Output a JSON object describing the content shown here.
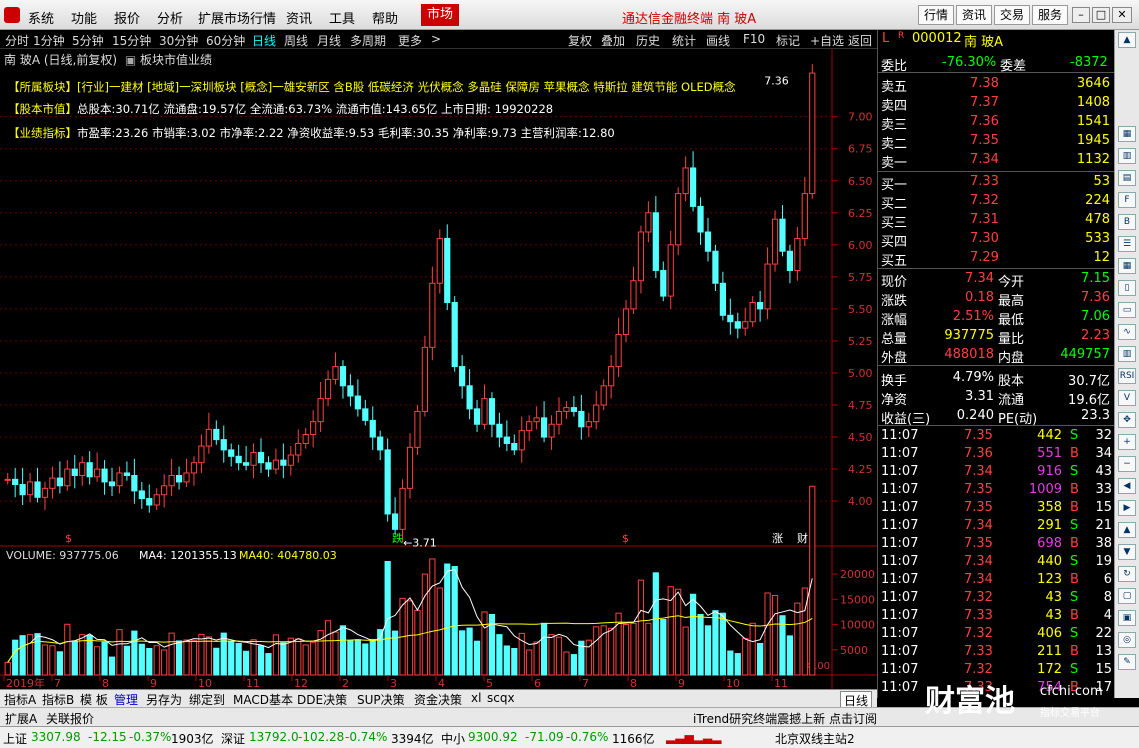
{
  "menu": {
    "items": [
      "系统",
      "功能",
      "报价",
      "分析",
      "扩展市场行情",
      "资讯",
      "工具",
      "帮助"
    ],
    "market": "市场",
    "title": "通达信金融终端  南 玻A",
    "right_buttons": [
      "行情",
      "资讯",
      "交易",
      "服务"
    ]
  },
  "periods": {
    "items": [
      "分时",
      "1分钟",
      "5分钟",
      "15分钟",
      "30分钟",
      "60分钟",
      "日线",
      "周线",
      "月线",
      "多周期",
      "更多"
    ],
    "active": "日线",
    "tools": [
      "复权",
      "叠加",
      "历史",
      "统计",
      "画线",
      "F10",
      "标记",
      "+自选",
      "返回"
    ]
  },
  "chart_head": {
    "title": "南 玻A (日线,前复权)",
    "tab": "板块市值业绩"
  },
  "info_lines": [
    {
      "key": "【所属板块】",
      "text": "[行业]一建材 [地域]一深圳板块 [概念]一雄安新区 含B股 低碳经济 光伏概念 多晶硅 保障房 苹果概念 特斯拉 建筑节能 OLED概念"
    },
    {
      "key": "【股本市值】",
      "text": "总股本:30.71亿 流通盘:19.57亿 全流通:63.73% 流通市值:143.65亿 上市日期: 19920228"
    },
    {
      "key": "【业绩指标】",
      "text": "市盈率:23.26 市销率:3.02 市净率:2.22 净资收益率:9.53 毛利率:30.35 净利率:9.73 主营利润率:12.80"
    }
  ],
  "chart_data": {
    "type": "candlestick",
    "price_axis_ticks": [
      4.0,
      4.25,
      4.5,
      4.75,
      5.0,
      5.25,
      5.5,
      5.75,
      6.0,
      6.25,
      6.5,
      6.75,
      7.0
    ],
    "ylim": [
      3.65,
      7.45
    ],
    "high_label": "7.36",
    "low_label": "3.71",
    "x_labels": [
      "2019年",
      "7",
      "8",
      "9",
      "10",
      "11",
      "12",
      "2",
      "3",
      "4",
      "5",
      "6",
      "7",
      "8",
      "9",
      "10",
      "11"
    ],
    "markers": [
      "$",
      "跌",
      "$",
      "涨",
      "财"
    ],
    "volume": {
      "title": "VOLUME: 937775.06",
      "ma4": "MA4: 1201355.13",
      "ma40": "MA40: 404780.03",
      "ticks": [
        "20000",
        "15000",
        "10000",
        "5000"
      ],
      "unit": "X100",
      "ylim": [
        0,
        22000
      ]
    },
    "closes": [
      4.17,
      4.13,
      4.05,
      4.15,
      4.03,
      4.1,
      4.18,
      4.12,
      4.25,
      4.2,
      4.3,
      4.19,
      4.25,
      4.15,
      4.12,
      4.22,
      4.2,
      4.08,
      4.02,
      3.97,
      4.05,
      4.12,
      4.2,
      4.15,
      4.22,
      4.3,
      4.43,
      4.56,
      4.48,
      4.4,
      4.35,
      4.3,
      4.28,
      4.38,
      4.3,
      4.25,
      4.32,
      4.28,
      4.36,
      4.45,
      4.52,
      4.62,
      4.8,
      4.95,
      5.05,
      4.9,
      4.82,
      4.72,
      4.63,
      4.5,
      4.4,
      3.9,
      3.78,
      4.1,
      4.42,
      4.7,
      5.2,
      5.7,
      6.05,
      5.55,
      5.05,
      4.9,
      4.72,
      4.6,
      4.8,
      4.6,
      4.5,
      4.45,
      4.4,
      4.55,
      4.62,
      4.65,
      4.5,
      4.6,
      4.7,
      4.73,
      4.7,
      4.58,
      4.62,
      4.75,
      4.9,
      5.05,
      5.3,
      5.5,
      5.72,
      6.1,
      6.25,
      5.8,
      5.6,
      6.0,
      6.4,
      6.6,
      6.3,
      6.1,
      5.95,
      5.7,
      5.45,
      5.4,
      5.35,
      5.4,
      5.55,
      5.5,
      5.85,
      6.2,
      5.95,
      5.8,
      6.05,
      6.4,
      7.34
    ]
  },
  "quote": {
    "code": "000012",
    "name": "南 玻A",
    "wb_label": "委比",
    "wb": "-76.30%",
    "wc_label": "委差",
    "wc": "-8372",
    "sells": [
      {
        "l": "卖五",
        "p": "7.38",
        "v": "3646"
      },
      {
        "l": "卖四",
        "p": "7.37",
        "v": "1408"
      },
      {
        "l": "卖三",
        "p": "7.36",
        "v": "1541"
      },
      {
        "l": "卖二",
        "p": "7.35",
        "v": "1945"
      },
      {
        "l": "卖一",
        "p": "7.34",
        "v": "1132"
      }
    ],
    "buys": [
      {
        "l": "买一",
        "p": "7.33",
        "v": "53"
      },
      {
        "l": "买二",
        "p": "7.32",
        "v": "224"
      },
      {
        "l": "买三",
        "p": "7.31",
        "v": "478"
      },
      {
        "l": "买四",
        "p": "7.30",
        "v": "533"
      },
      {
        "l": "买五",
        "p": "7.29",
        "v": "12"
      }
    ],
    "stats": [
      {
        "l1": "现价",
        "v1": "7.34",
        "c1": "red",
        "l2": "今开",
        "v2": "7.15",
        "c2": "grn"
      },
      {
        "l1": "涨跌",
        "v1": "0.18",
        "c1": "red",
        "l2": "最高",
        "v2": "7.36",
        "c2": "red"
      },
      {
        "l1": "涨幅",
        "v1": "2.51%",
        "c1": "red",
        "l2": "最低",
        "v2": "7.06",
        "c2": "grn"
      },
      {
        "l1": "总量",
        "v1": "937775",
        "c1": "yel",
        "l2": "量比",
        "v2": "2.23",
        "c2": "red"
      },
      {
        "l1": "外盘",
        "v1": "488018",
        "c1": "red",
        "l2": "内盘",
        "v2": "449757",
        "c2": "grn"
      },
      {
        "l1": "换手",
        "v1": "4.79%",
        "c1": "wht",
        "l2": "股本",
        "v2": "30.7亿",
        "c2": "wht"
      },
      {
        "l1": "净资",
        "v1": "3.31",
        "c1": "wht",
        "l2": "流通",
        "v2": "19.6亿",
        "c2": "wht"
      },
      {
        "l1": "收益(三)",
        "v1": "0.240",
        "c1": "wht",
        "l2": "PE(动)",
        "v2": "23.3",
        "c2": "wht"
      }
    ],
    "ticks": [
      {
        "t": "11:07",
        "p": "7.35",
        "pc": "red",
        "v": "442",
        "vc": "yel",
        "s": "S",
        "n": "32"
      },
      {
        "t": "11:07",
        "p": "7.36",
        "pc": "red",
        "v": "551",
        "vc": "mag",
        "s": "B",
        "n": "34"
      },
      {
        "t": "11:07",
        "p": "7.34",
        "pc": "red",
        "v": "916",
        "vc": "mag",
        "s": "S",
        "n": "43"
      },
      {
        "t": "11:07",
        "p": "7.35",
        "pc": "red",
        "v": "1009",
        "vc": "mag",
        "s": "B",
        "n": "33"
      },
      {
        "t": "11:07",
        "p": "7.35",
        "pc": "red",
        "v": "358",
        "vc": "yel",
        "s": "B",
        "n": "15"
      },
      {
        "t": "11:07",
        "p": "7.34",
        "pc": "red",
        "v": "291",
        "vc": "yel",
        "s": "S",
        "n": "21"
      },
      {
        "t": "11:07",
        "p": "7.35",
        "pc": "red",
        "v": "698",
        "vc": "mag",
        "s": "B",
        "n": "38"
      },
      {
        "t": "11:07",
        "p": "7.34",
        "pc": "red",
        "v": "440",
        "vc": "yel",
        "s": "S",
        "n": "19"
      },
      {
        "t": "11:07",
        "p": "7.34",
        "pc": "red",
        "v": "123",
        "vc": "yel",
        "s": "B",
        "n": "6"
      },
      {
        "t": "11:07",
        "p": "7.32",
        "pc": "red",
        "v": "43",
        "vc": "yel",
        "s": "S",
        "n": "8"
      },
      {
        "t": "11:07",
        "p": "7.33",
        "pc": "red",
        "v": "43",
        "vc": "yel",
        "s": "B",
        "n": "4"
      },
      {
        "t": "11:07",
        "p": "7.32",
        "pc": "red",
        "v": "406",
        "vc": "yel",
        "s": "S",
        "n": "22"
      },
      {
        "t": "11:07",
        "p": "7.33",
        "pc": "red",
        "v": "211",
        "vc": "yel",
        "s": "B",
        "n": "13"
      },
      {
        "t": "11:07",
        "p": "7.32",
        "pc": "red",
        "v": "172",
        "vc": "yel",
        "s": "S",
        "n": "15"
      },
      {
        "t": "11:07",
        "p": "7.33",
        "pc": "red",
        "v": "754",
        "vc": "mag",
        "s": "B",
        "n": "17"
      }
    ]
  },
  "bottom_tabs": [
    "指标A",
    "指标B",
    "模 板",
    "管理",
    "另存为",
    "绑定到",
    "MACD基本",
    "DDE决策",
    "SUP决策",
    "资金决策",
    "xl",
    "scqx"
  ],
  "bottom_period": "日线",
  "bottom_tabs2": [
    "扩展A",
    "关联报价"
  ],
  "news": "iTrend研究终端震撼上新 点击订阅",
  "status": {
    "sh": {
      "label": "上证",
      "val": "3307.98",
      "chg": "-12.15",
      "pct": "-0.37%",
      "amt": "1903亿"
    },
    "sz": {
      "label": "深证",
      "val": "13792.0",
      "chg": "-102.28",
      "pct": "-0.74%",
      "amt": "3394亿"
    },
    "zx": {
      "label": "中小",
      "val": "9300.92",
      "chg": "-71.09",
      "pct": "-0.76%",
      "amt": "1166亿"
    },
    "server": "北京双线主站2"
  },
  "watermark": {
    "big": "财富池",
    "site": "cfchi.com",
    "sub": "指标交易平台"
  }
}
